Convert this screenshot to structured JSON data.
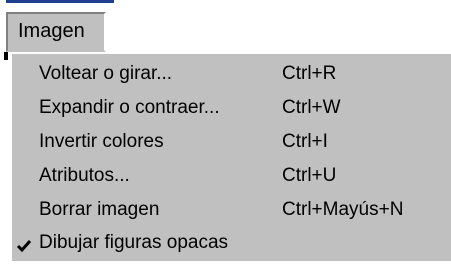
{
  "menubar": {
    "item_label": "Imagen"
  },
  "menu": {
    "items": [
      {
        "label": "Voltear o girar...",
        "shortcut": "Ctrl+R",
        "checked": false
      },
      {
        "label": "Expandir o contraer...",
        "shortcut": "Ctrl+W",
        "checked": false
      },
      {
        "label": "Invertir colores",
        "shortcut": "Ctrl+I",
        "checked": false
      },
      {
        "label": "Atributos...",
        "shortcut": "Ctrl+U",
        "checked": false
      },
      {
        "label": "Borrar imagen",
        "shortcut": "Ctrl+Mayús+N",
        "checked": false
      },
      {
        "label": "Dibujar figuras opacas",
        "shortcut": "",
        "checked": true
      }
    ]
  },
  "icons": {
    "check": "check-icon"
  },
  "colors": {
    "menu_bg": "#c0c0c0",
    "accent_line": "#1c3f8f",
    "text": "#000000"
  }
}
